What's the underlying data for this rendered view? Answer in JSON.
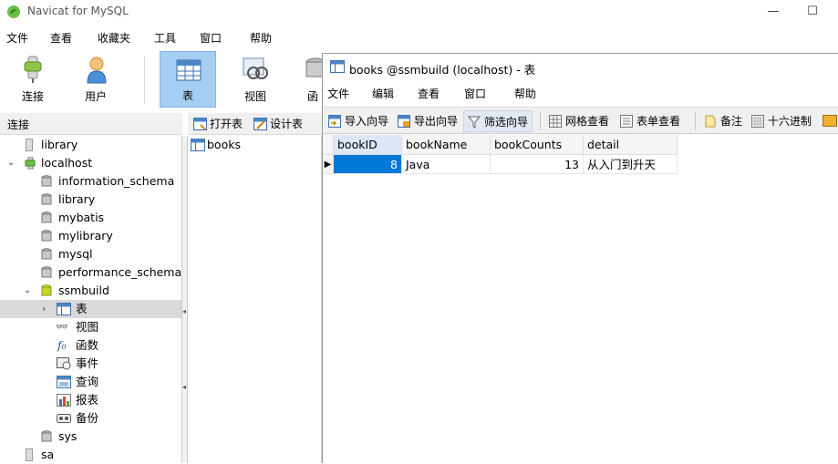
{
  "app": {
    "title": "Navicat for MySQL"
  },
  "menubar": [
    "文件",
    "查看",
    "收藏夹",
    "工具",
    "窗口",
    "帮助"
  ],
  "toolbar": {
    "connect": "连接",
    "user": "用户",
    "table": "表",
    "view": "视图",
    "function": "函"
  },
  "conn_header": "连接",
  "obj_toolbar": {
    "open_table": "打开表",
    "design_table": "设计表"
  },
  "tree": {
    "items": [
      {
        "label": "library"
      },
      {
        "label": "localhost"
      },
      {
        "label": "information_schema"
      },
      {
        "label": "library"
      },
      {
        "label": "mybatis"
      },
      {
        "label": "mylibrary"
      },
      {
        "label": "mysql"
      },
      {
        "label": "performance_schema"
      },
      {
        "label": "ssmbuild"
      },
      {
        "label": "表"
      },
      {
        "label": "视图"
      },
      {
        "label": "函数"
      },
      {
        "label": "事件"
      },
      {
        "label": "查询"
      },
      {
        "label": "报表"
      },
      {
        "label": "备份"
      },
      {
        "label": "sys"
      },
      {
        "label": "sa"
      }
    ]
  },
  "object_pane": {
    "items": [
      "books"
    ]
  },
  "child": {
    "title": "books @ssmbuild (localhost) - 表",
    "menubar": [
      "文件",
      "编辑",
      "查看",
      "窗口",
      "帮助"
    ],
    "toolbar": {
      "import": "导入向导",
      "export": "导出向导",
      "filter": "筛选向导",
      "grid_view": "网格查看",
      "form_view": "表单查看",
      "memo": "备注",
      "hex": "十六进制"
    },
    "grid": {
      "columns": [
        "bookID",
        "bookName",
        "bookCounts",
        "detail"
      ],
      "rows": [
        [
          "8",
          "Java",
          "13",
          "从入门到升天"
        ]
      ]
    }
  },
  "colors": {
    "accent": "#0078d7",
    "active_tool": "#a6cdf2",
    "selection": "#d9d9d9"
  }
}
